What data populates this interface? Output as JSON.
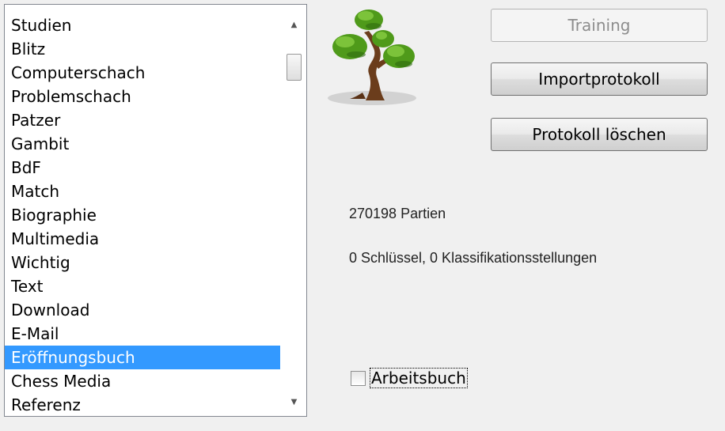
{
  "list": {
    "items": [
      "Studien",
      "Blitz",
      "Computerschach",
      "Problemschach",
      "Patzer",
      "Gambit",
      "BdF",
      "Match",
      "Biographie",
      "Multimedia",
      "Wichtig",
      "Text",
      "Download",
      "E-Mail",
      "Eröffnungsbuch",
      "Chess Media",
      "Referenz"
    ],
    "selected_item": "Eröffnungsbuch",
    "scroll_up_glyph": "▲",
    "scroll_down_glyph": "▼"
  },
  "buttons": {
    "training": "Training",
    "import_log": "Importprotokoll",
    "delete_log": "Protokoll löschen"
  },
  "info": {
    "games": "270198 Partien",
    "keys": "0 Schlüssel, 0 Klassifikationsstellungen"
  },
  "checkbox": {
    "label": "Arbeitsbuch",
    "checked": false
  },
  "colors": {
    "selection": "#3399ff",
    "tree_foliage": "#4f9a1a",
    "tree_trunk": "#6b3d1c"
  },
  "icons": {
    "logo": "bonsai-tree-icon"
  }
}
